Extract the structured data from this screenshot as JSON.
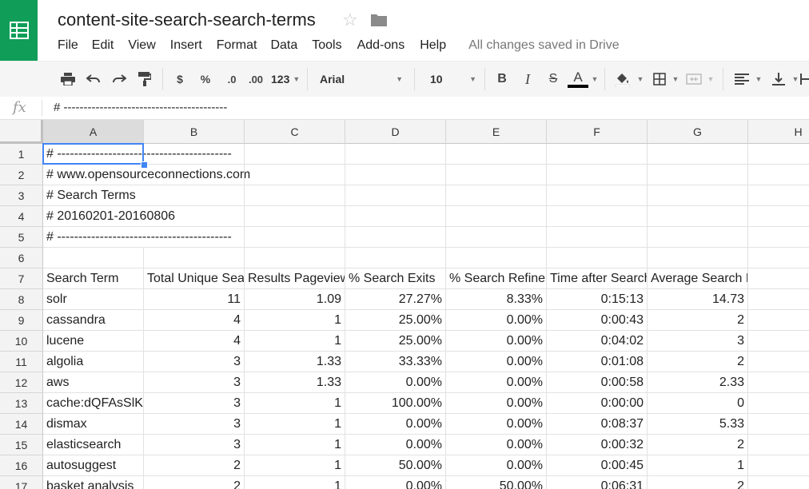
{
  "app": {
    "doc_title": "content-site-search-search-terms",
    "saved_status": "All changes saved in Drive"
  },
  "menu": [
    "File",
    "Edit",
    "View",
    "Insert",
    "Format",
    "Data",
    "Tools",
    "Add-ons",
    "Help"
  ],
  "toolbar": {
    "currency": "$",
    "percent": "%",
    "decrease_decimal": ".0",
    "increase_decimal": ".00",
    "number_format": "123",
    "font": "Arial",
    "font_size": "10",
    "bold": "B",
    "italic": "I",
    "strike": "S",
    "text_color": "A"
  },
  "formula_bar": {
    "fx": "fx",
    "content": "# -----------------------------------------"
  },
  "columns": [
    "A",
    "B",
    "C",
    "D",
    "E",
    "F",
    "G",
    "H"
  ],
  "rows": [
    [
      "# -----------------------------------------",
      "",
      "",
      "",
      "",
      "",
      ""
    ],
    [
      "# www.opensourceconnections.com",
      "",
      "",
      "",
      "",
      "",
      ""
    ],
    [
      "# Search Terms",
      "",
      "",
      "",
      "",
      "",
      ""
    ],
    [
      "# 20160201-20160806",
      "",
      "",
      "",
      "",
      "",
      ""
    ],
    [
      "# -----------------------------------------",
      "",
      "",
      "",
      "",
      "",
      ""
    ],
    [
      "",
      "",
      "",
      "",
      "",
      "",
      ""
    ],
    [
      "Search Term",
      "Total Unique Searches",
      "Results Pageviews / Search",
      "% Search Exits",
      "% Search Refinements",
      "Time after Search",
      "Average Search Depth"
    ],
    [
      "solr",
      "11",
      "1.09",
      "27.27%",
      "8.33%",
      "0:15:13",
      "14.73"
    ],
    [
      "cassandra",
      "4",
      "1",
      "25.00%",
      "0.00%",
      "0:00:43",
      "2"
    ],
    [
      "lucene",
      "4",
      "1",
      "25.00%",
      "0.00%",
      "0:04:02",
      "3"
    ],
    [
      "algolia",
      "3",
      "1.33",
      "33.33%",
      "0.00%",
      "0:01:08",
      "2"
    ],
    [
      "aws",
      "3",
      "1.33",
      "0.00%",
      "0.00%",
      "0:00:58",
      "2.33"
    ],
    [
      "cache:dQFAsSlKrWoJ:opensourceconnections.com",
      "3",
      "1",
      "100.00%",
      "0.00%",
      "0:00:00",
      "0"
    ],
    [
      "dismax",
      "3",
      "1",
      "0.00%",
      "0.00%",
      "0:08:37",
      "5.33"
    ],
    [
      "elasticsearch",
      "3",
      "1",
      "0.00%",
      "0.00%",
      "0:00:32",
      "2"
    ],
    [
      "autosuggest",
      "2",
      "1",
      "50.00%",
      "0.00%",
      "0:00:45",
      "1"
    ],
    [
      "basket analysis",
      "2",
      "1",
      "0.00%",
      "50.00%",
      "0:06:31",
      "2"
    ]
  ],
  "colors": {
    "brand": "#0f9d58",
    "selection": "#4285f4"
  }
}
